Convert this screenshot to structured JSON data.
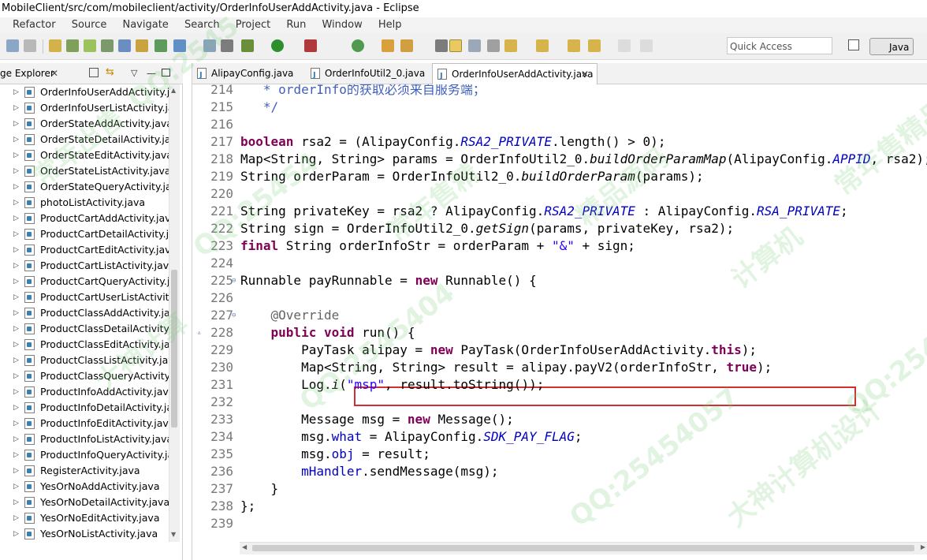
{
  "window": {
    "title": "MobileClient/src/com/mobileclient/activity/OrderInfoUserAddActivity.java - Eclipse"
  },
  "menu": [
    "Refactor",
    "Source",
    "Navigate",
    "Search",
    "Project",
    "Run",
    "Window",
    "Help"
  ],
  "toolbar": {
    "quick_access": "Quick Access",
    "perspective": "Java"
  },
  "package_explorer": {
    "title": "ge Explorer",
    "files": [
      "OrderInfoUserAddActivity.ja",
      "OrderInfoUserListActivity.ja",
      "OrderStateAddActivity.java",
      "OrderStateDetailActivity.java",
      "OrderStateEditActivity.java",
      "OrderStateListActivity.java",
      "OrderStateQueryActivity.jav",
      "photoListActivity.java",
      "ProductCartAddActivity.java",
      "ProductCartDetailActivity.jav",
      "ProductCartEditActivity.java",
      "ProductCartListActivity.java",
      "ProductCartQueryActivity.ja",
      "ProductCartUserListActivity.",
      "ProductClassAddActivity.jav",
      "ProductClassDetailActivity.ja",
      "ProductClassEditActivity.java",
      "ProductClassListActivity.java",
      "ProductClassQueryActivity.ja",
      "ProductInfoAddActivity.java",
      "ProductInfoDetailActivity.jav",
      "ProductInfoEditActivity.java",
      "ProductInfoListActivity.java",
      "ProductInfoQueryActivity.jav",
      "RegisterActivity.java",
      "YesOrNoAddActivity.java",
      "YesOrNoDetailActivity.java",
      "YesOrNoEditActivity.java",
      "YesOrNoListActivity.java"
    ]
  },
  "editor": {
    "tabs": [
      "AlipayConfig.java",
      "OrderInfoUtil2_0.java",
      "OrderInfoUserAddActivity.java"
    ],
    "active_tab": 2,
    "line_numbers": [
      "214",
      "215",
      "216",
      "217",
      "218",
      "219",
      "220",
      "221",
      "222",
      "223",
      "224",
      "225",
      "226",
      "227",
      "228",
      "229",
      "230",
      "231",
      "232",
      "233",
      "234",
      "235",
      "236",
      "237",
      "238",
      "239"
    ]
  },
  "watermarks": [
    "QQ:2545",
    "常年出售",
    "QQ:25454",
    "大神计算",
    "QQ:2545404",
    "常年售精",
    "精品源码",
    "计算机",
    "QQ:25454057",
    "大神计算机设计",
    "常年售精品源",
    "QQ:2545"
  ]
}
